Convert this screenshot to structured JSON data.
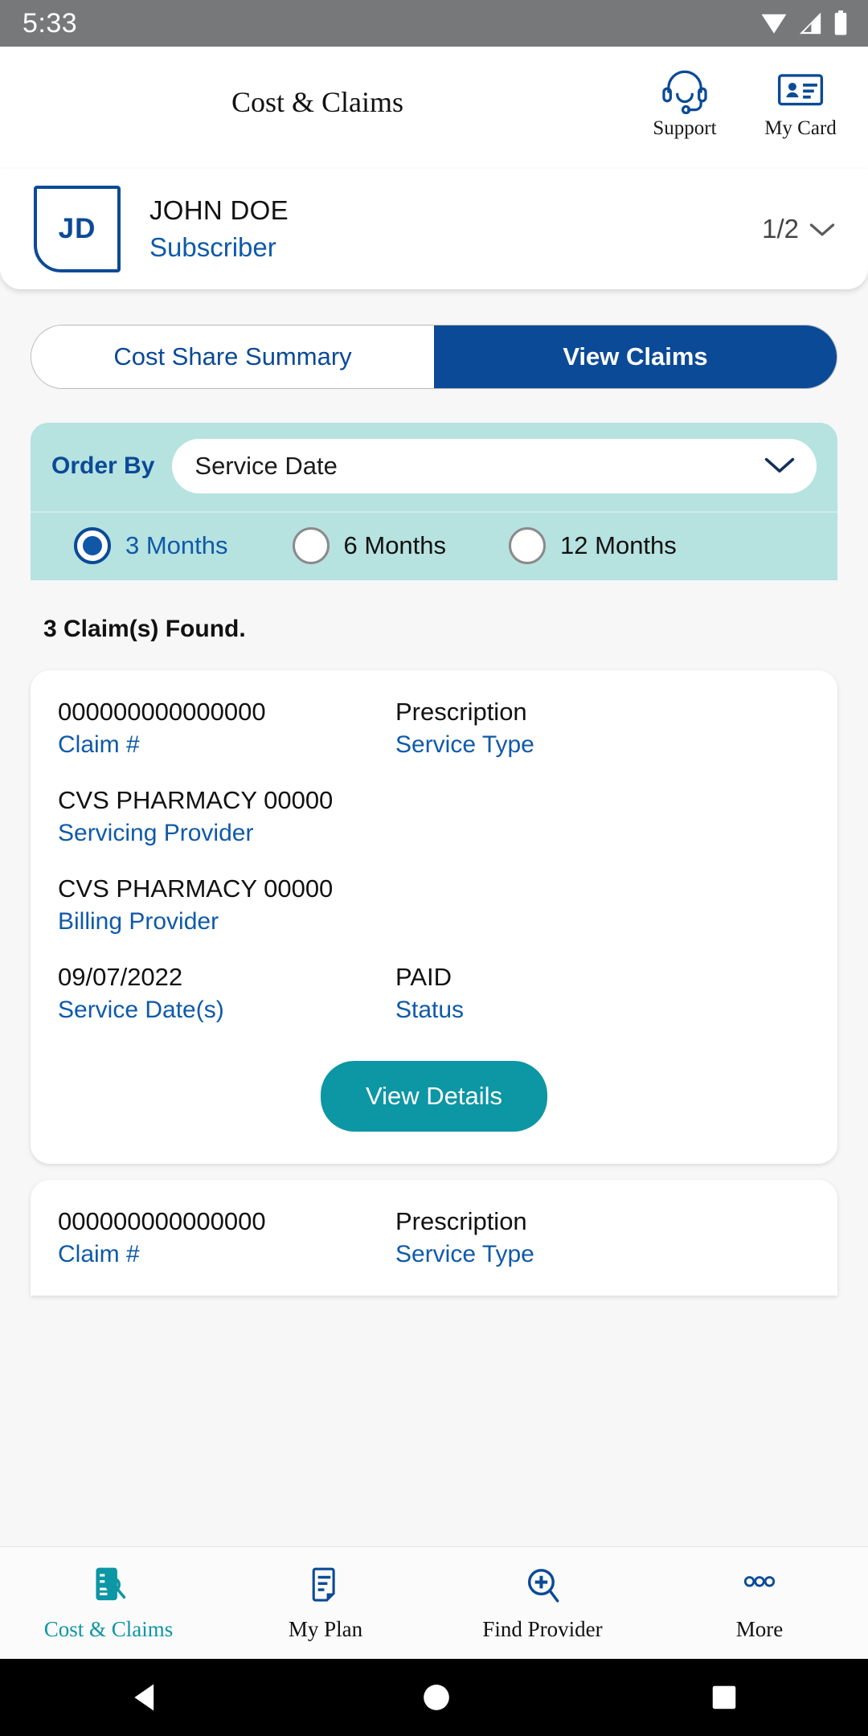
{
  "status_bar": {
    "time": "5:33",
    "icons": [
      "wifi-icon",
      "signal-icon",
      "battery-icon"
    ]
  },
  "header": {
    "title": "Cost & Claims",
    "actions": [
      {
        "label": "Support",
        "icon": "headset-icon"
      },
      {
        "label": "My Card",
        "icon": "id-card-icon"
      }
    ]
  },
  "member": {
    "initials": "JD",
    "name": "JOHN DOE",
    "role": "Subscriber",
    "pager": "1/2",
    "pager_icon": "chevron-down-icon"
  },
  "tabs": [
    {
      "label": "Cost Share Summary",
      "active": false
    },
    {
      "label": "View Claims",
      "active": true
    }
  ],
  "filters": {
    "order_by_label": "Order By",
    "order_by_value": "Service Date",
    "order_by_options": [
      "Service Date"
    ],
    "periods": [
      {
        "label": "3 Months",
        "selected": true
      },
      {
        "label": "6 Months",
        "selected": false
      },
      {
        "label": "12 Months",
        "selected": false
      }
    ]
  },
  "results": {
    "found_text": "3 Claim(s) Found.",
    "field_labels": {
      "claim": "Claim #",
      "service_type": "Service Type",
      "servicing_provider": "Servicing Provider",
      "billing_provider": "Billing Provider",
      "service_dates": "Service Date(s)",
      "status": "Status"
    },
    "view_details_label": "View Details",
    "claims": [
      {
        "claim_number": "000000000000000",
        "service_type": "Prescription",
        "servicing_provider": "CVS PHARMACY 00000",
        "billing_provider": "CVS PHARMACY 00000",
        "service_date": "09/07/2022",
        "status": "PAID"
      },
      {
        "claim_number": "000000000000000",
        "service_type": "Prescription"
      }
    ]
  },
  "bottom_nav": [
    {
      "label": "Cost & Claims",
      "icon": "claims-search-icon",
      "active": true
    },
    {
      "label": "My Plan",
      "icon": "document-icon",
      "active": false
    },
    {
      "label": "Find Provider",
      "icon": "provider-search-icon",
      "active": false
    },
    {
      "label": "More",
      "icon": "more-dots-icon",
      "active": false
    }
  ],
  "system_nav": [
    {
      "name": "back-button",
      "icon": "triangle-left"
    },
    {
      "name": "home-button",
      "icon": "circle"
    },
    {
      "name": "recents-button",
      "icon": "square"
    }
  ],
  "colors": {
    "brand_blue": "#0b4a96",
    "link_blue": "#0f5aa8",
    "teal": "#0d96a4",
    "filter_bg": "#b6e2e0",
    "status_bar": "#77787a"
  }
}
